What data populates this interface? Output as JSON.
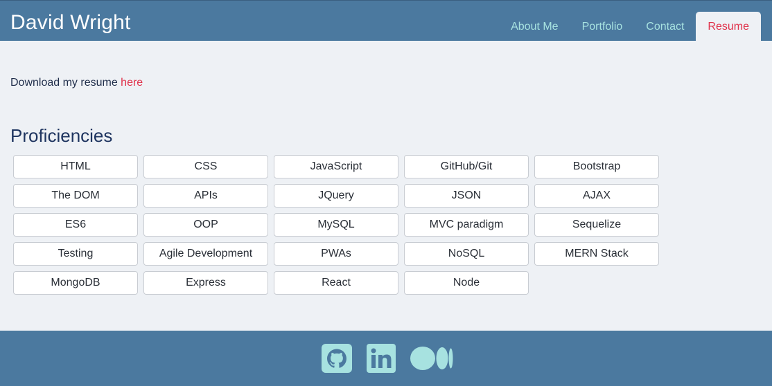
{
  "header": {
    "brand": "David Wright",
    "nav": [
      {
        "label": "About Me",
        "active": false
      },
      {
        "label": "Portfolio",
        "active": false
      },
      {
        "label": "Contact",
        "active": false
      },
      {
        "label": "Resume",
        "active": true
      }
    ]
  },
  "resume": {
    "download_text": "Download my resume ",
    "download_link": "here"
  },
  "proficiencies": {
    "title": "Proficiencies",
    "items": [
      "HTML",
      "CSS",
      "JavaScript",
      "GitHub/Git",
      "Bootstrap",
      "The DOM",
      "APIs",
      "JQuery",
      "JSON",
      "AJAX",
      "ES6",
      "OOP",
      "MySQL",
      "MVC paradigm",
      "Sequelize",
      "Testing",
      "Agile Development",
      "PWAs",
      "NoSQL",
      "MERN Stack",
      "MongoDB",
      "Express",
      "React",
      "Node"
    ]
  },
  "footer": {
    "icons": [
      "github-icon",
      "linkedin-icon",
      "medium-icon"
    ]
  },
  "colors": {
    "header_bg": "#4b799f",
    "page_bg": "#eef1f5",
    "nav_text": "#a7e2e0",
    "accent": "#e0314a",
    "icon": "#a7e2e0"
  }
}
